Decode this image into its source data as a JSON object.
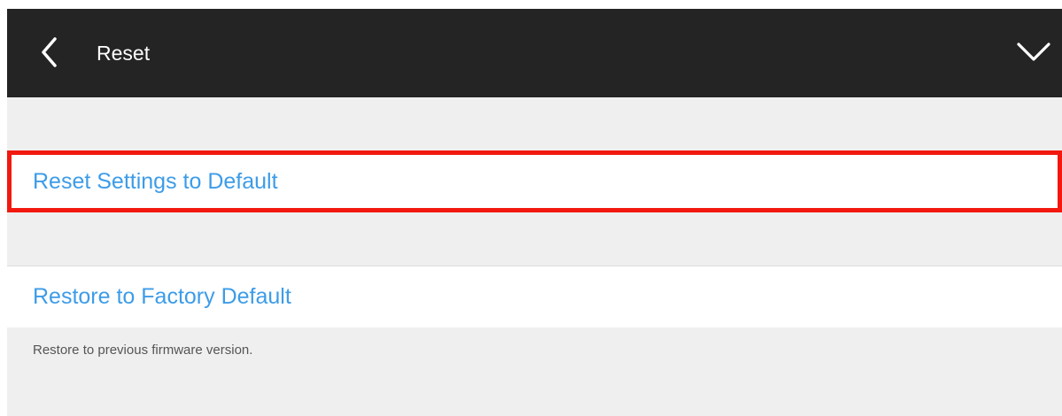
{
  "navbar": {
    "back_icon": "chevron-left-icon",
    "title": "Reset",
    "dropdown_icon": "chevron-down-icon"
  },
  "settings": {
    "reset_label": "Reset Settings to Default",
    "restore_label": "Restore to Factory Default",
    "restore_note": "Restore to previous firmware version."
  },
  "colors": {
    "navbar_bg": "#242424",
    "page_bg": "#efeff0",
    "link_blue": "#3d9ce8",
    "highlight_red": "#f2180f",
    "note_gray": "#555555"
  }
}
